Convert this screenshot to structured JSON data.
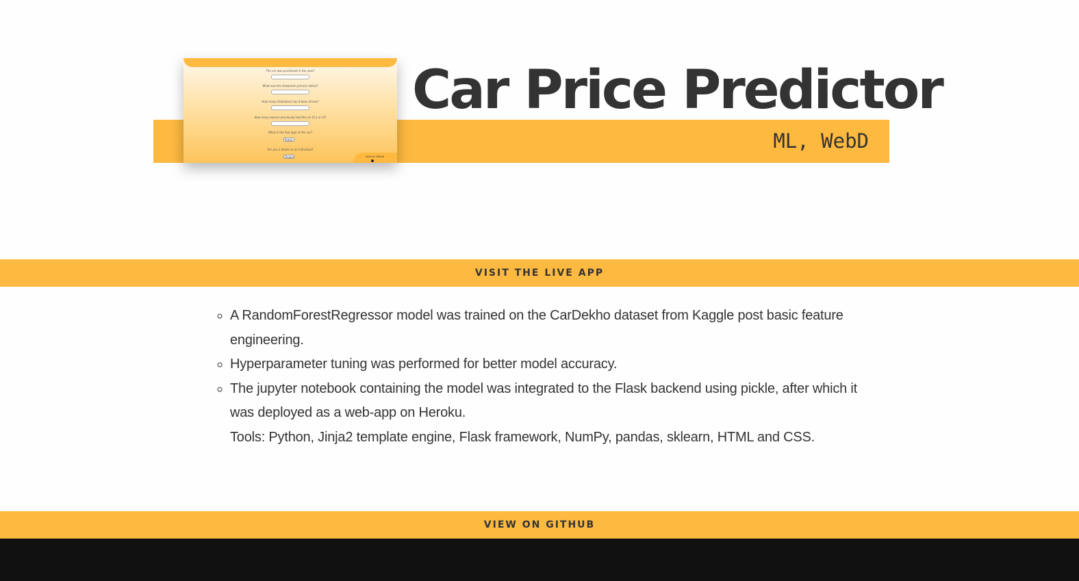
{
  "project": {
    "title": "Car Price Predictor",
    "tags": "ML, WebD"
  },
  "thumbnail": {
    "questions": [
      "The car was purchased in the year?",
      "What was the showroom price(in lakhs)?",
      "How many kilometres has it been driven?",
      "How many owners previously had the car (0,1 or 3)?",
      "What is the fuel type of the car?",
      "Are you a dealer or an individual?"
    ],
    "fuel_select": "Petrol",
    "seller_select": "Dealer",
    "github_label": "View on GitHub"
  },
  "links": {
    "live_app": "VISIT THE LIVE APP",
    "github": "VIEW ON GITHUB"
  },
  "description": {
    "items": [
      "A RandomForestRegressor model was trained on the CarDekho dataset from Kaggle post basic feature engineering.",
      "Hyperparameter tuning was performed for better model accuracy.",
      "The jupyter notebook containing the model was integrated to the Flask backend using pickle, after which it was deployed as a web-app on Heroku."
    ],
    "tools": "Tools: Python, Jinja2 template engine, Flask framework, NumPy, pandas, sklearn, HTML and CSS."
  },
  "colors": {
    "accent": "#fdb940",
    "text": "#333333",
    "footer": "#111111"
  }
}
